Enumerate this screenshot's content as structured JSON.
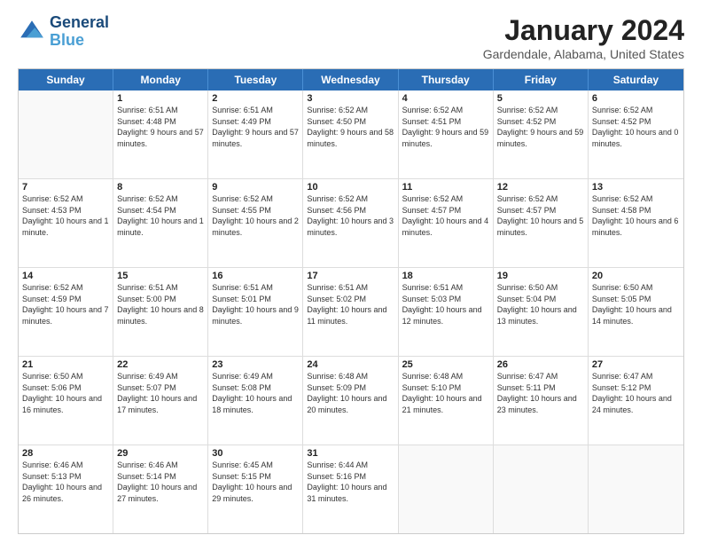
{
  "logo": {
    "line1": "General",
    "line2": "Blue"
  },
  "title": "January 2024",
  "location": "Gardendale, Alabama, United States",
  "header_days": [
    "Sunday",
    "Monday",
    "Tuesday",
    "Wednesday",
    "Thursday",
    "Friday",
    "Saturday"
  ],
  "rows": [
    [
      {
        "day": "",
        "sunrise": "",
        "sunset": "",
        "daylight": ""
      },
      {
        "day": "1",
        "sunrise": "Sunrise: 6:51 AM",
        "sunset": "Sunset: 4:48 PM",
        "daylight": "Daylight: 9 hours and 57 minutes."
      },
      {
        "day": "2",
        "sunrise": "Sunrise: 6:51 AM",
        "sunset": "Sunset: 4:49 PM",
        "daylight": "Daylight: 9 hours and 57 minutes."
      },
      {
        "day": "3",
        "sunrise": "Sunrise: 6:52 AM",
        "sunset": "Sunset: 4:50 PM",
        "daylight": "Daylight: 9 hours and 58 minutes."
      },
      {
        "day": "4",
        "sunrise": "Sunrise: 6:52 AM",
        "sunset": "Sunset: 4:51 PM",
        "daylight": "Daylight: 9 hours and 59 minutes."
      },
      {
        "day": "5",
        "sunrise": "Sunrise: 6:52 AM",
        "sunset": "Sunset: 4:52 PM",
        "daylight": "Daylight: 9 hours and 59 minutes."
      },
      {
        "day": "6",
        "sunrise": "Sunrise: 6:52 AM",
        "sunset": "Sunset: 4:52 PM",
        "daylight": "Daylight: 10 hours and 0 minutes."
      }
    ],
    [
      {
        "day": "7",
        "sunrise": "Sunrise: 6:52 AM",
        "sunset": "Sunset: 4:53 PM",
        "daylight": "Daylight: 10 hours and 1 minute."
      },
      {
        "day": "8",
        "sunrise": "Sunrise: 6:52 AM",
        "sunset": "Sunset: 4:54 PM",
        "daylight": "Daylight: 10 hours and 1 minute."
      },
      {
        "day": "9",
        "sunrise": "Sunrise: 6:52 AM",
        "sunset": "Sunset: 4:55 PM",
        "daylight": "Daylight: 10 hours and 2 minutes."
      },
      {
        "day": "10",
        "sunrise": "Sunrise: 6:52 AM",
        "sunset": "Sunset: 4:56 PM",
        "daylight": "Daylight: 10 hours and 3 minutes."
      },
      {
        "day": "11",
        "sunrise": "Sunrise: 6:52 AM",
        "sunset": "Sunset: 4:57 PM",
        "daylight": "Daylight: 10 hours and 4 minutes."
      },
      {
        "day": "12",
        "sunrise": "Sunrise: 6:52 AM",
        "sunset": "Sunset: 4:57 PM",
        "daylight": "Daylight: 10 hours and 5 minutes."
      },
      {
        "day": "13",
        "sunrise": "Sunrise: 6:52 AM",
        "sunset": "Sunset: 4:58 PM",
        "daylight": "Daylight: 10 hours and 6 minutes."
      }
    ],
    [
      {
        "day": "14",
        "sunrise": "Sunrise: 6:52 AM",
        "sunset": "Sunset: 4:59 PM",
        "daylight": "Daylight: 10 hours and 7 minutes."
      },
      {
        "day": "15",
        "sunrise": "Sunrise: 6:51 AM",
        "sunset": "Sunset: 5:00 PM",
        "daylight": "Daylight: 10 hours and 8 minutes."
      },
      {
        "day": "16",
        "sunrise": "Sunrise: 6:51 AM",
        "sunset": "Sunset: 5:01 PM",
        "daylight": "Daylight: 10 hours and 9 minutes."
      },
      {
        "day": "17",
        "sunrise": "Sunrise: 6:51 AM",
        "sunset": "Sunset: 5:02 PM",
        "daylight": "Daylight: 10 hours and 11 minutes."
      },
      {
        "day": "18",
        "sunrise": "Sunrise: 6:51 AM",
        "sunset": "Sunset: 5:03 PM",
        "daylight": "Daylight: 10 hours and 12 minutes."
      },
      {
        "day": "19",
        "sunrise": "Sunrise: 6:50 AM",
        "sunset": "Sunset: 5:04 PM",
        "daylight": "Daylight: 10 hours and 13 minutes."
      },
      {
        "day": "20",
        "sunrise": "Sunrise: 6:50 AM",
        "sunset": "Sunset: 5:05 PM",
        "daylight": "Daylight: 10 hours and 14 minutes."
      }
    ],
    [
      {
        "day": "21",
        "sunrise": "Sunrise: 6:50 AM",
        "sunset": "Sunset: 5:06 PM",
        "daylight": "Daylight: 10 hours and 16 minutes."
      },
      {
        "day": "22",
        "sunrise": "Sunrise: 6:49 AM",
        "sunset": "Sunset: 5:07 PM",
        "daylight": "Daylight: 10 hours and 17 minutes."
      },
      {
        "day": "23",
        "sunrise": "Sunrise: 6:49 AM",
        "sunset": "Sunset: 5:08 PM",
        "daylight": "Daylight: 10 hours and 18 minutes."
      },
      {
        "day": "24",
        "sunrise": "Sunrise: 6:48 AM",
        "sunset": "Sunset: 5:09 PM",
        "daylight": "Daylight: 10 hours and 20 minutes."
      },
      {
        "day": "25",
        "sunrise": "Sunrise: 6:48 AM",
        "sunset": "Sunset: 5:10 PM",
        "daylight": "Daylight: 10 hours and 21 minutes."
      },
      {
        "day": "26",
        "sunrise": "Sunrise: 6:47 AM",
        "sunset": "Sunset: 5:11 PM",
        "daylight": "Daylight: 10 hours and 23 minutes."
      },
      {
        "day": "27",
        "sunrise": "Sunrise: 6:47 AM",
        "sunset": "Sunset: 5:12 PM",
        "daylight": "Daylight: 10 hours and 24 minutes."
      }
    ],
    [
      {
        "day": "28",
        "sunrise": "Sunrise: 6:46 AM",
        "sunset": "Sunset: 5:13 PM",
        "daylight": "Daylight: 10 hours and 26 minutes."
      },
      {
        "day": "29",
        "sunrise": "Sunrise: 6:46 AM",
        "sunset": "Sunset: 5:14 PM",
        "daylight": "Daylight: 10 hours and 27 minutes."
      },
      {
        "day": "30",
        "sunrise": "Sunrise: 6:45 AM",
        "sunset": "Sunset: 5:15 PM",
        "daylight": "Daylight: 10 hours and 29 minutes."
      },
      {
        "day": "31",
        "sunrise": "Sunrise: 6:44 AM",
        "sunset": "Sunset: 5:16 PM",
        "daylight": "Daylight: 10 hours and 31 minutes."
      },
      {
        "day": "",
        "sunrise": "",
        "sunset": "",
        "daylight": ""
      },
      {
        "day": "",
        "sunrise": "",
        "sunset": "",
        "daylight": ""
      },
      {
        "day": "",
        "sunrise": "",
        "sunset": "",
        "daylight": ""
      }
    ]
  ]
}
